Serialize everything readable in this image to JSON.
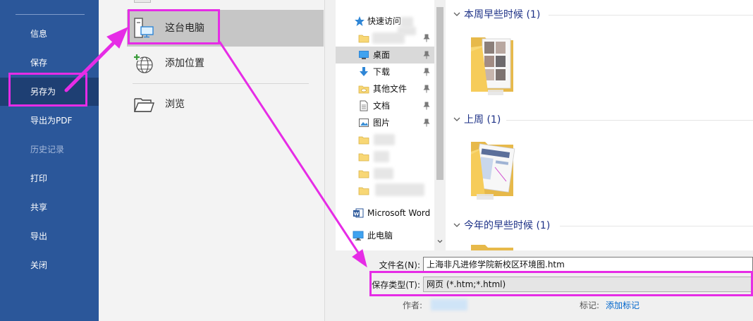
{
  "nav": {
    "items": [
      {
        "label": "信息",
        "state": "normal"
      },
      {
        "label": "保存",
        "state": "normal"
      },
      {
        "label": "另存为",
        "state": "active"
      },
      {
        "label": "导出为PDF",
        "state": "normal"
      },
      {
        "label": "历史记录",
        "state": "disabled"
      },
      {
        "label": "打印",
        "state": "normal"
      },
      {
        "label": "共享",
        "state": "normal"
      },
      {
        "label": "导出",
        "state": "normal"
      },
      {
        "label": "关闭",
        "state": "normal"
      }
    ]
  },
  "locations": {
    "items": [
      {
        "label": "这台电脑",
        "icon": "this-pc-icon",
        "selected": true
      },
      {
        "label": "添加位置",
        "icon": "add-location-globe-icon",
        "selected": false
      },
      {
        "label": "浏览",
        "icon": "browse-folder-icon",
        "selected": false
      }
    ]
  },
  "navpane": {
    "quick_access": "快速访问",
    "items": [
      {
        "label": "桌面",
        "icon": "desktop-icon",
        "pinned": true
      },
      {
        "label": "下载",
        "icon": "download-icon",
        "pinned": true
      },
      {
        "label": "其他文件",
        "icon": "cloud-folder-icon",
        "pinned": true
      },
      {
        "label": "文档",
        "icon": "documents-icon",
        "pinned": true
      },
      {
        "label": "图片",
        "icon": "pictures-icon",
        "pinned": true
      }
    ],
    "word": "Microsoft Word",
    "this_pc": "此电脑"
  },
  "files": {
    "groups": [
      {
        "label": "本周早些时候 (1)"
      },
      {
        "label": "上周 (1)"
      },
      {
        "label": "今年的早些时候 (1)"
      }
    ]
  },
  "form": {
    "filename_label": "文件名(N):",
    "filename_value": "上海非凡进修学院新校区环境图.htm",
    "savetype_label": "保存类型(T):",
    "savetype_value": "网页 (*.htm;*.html)",
    "author_label": "作者:",
    "tags_label": "标记:",
    "tags_link": "添加标记"
  },
  "colors": {
    "nav_bg": "#2b579a",
    "nav_active": "#1e3f73",
    "annotation": "#e62ce6",
    "group_header": "#1e3287",
    "link": "#0066cc"
  }
}
